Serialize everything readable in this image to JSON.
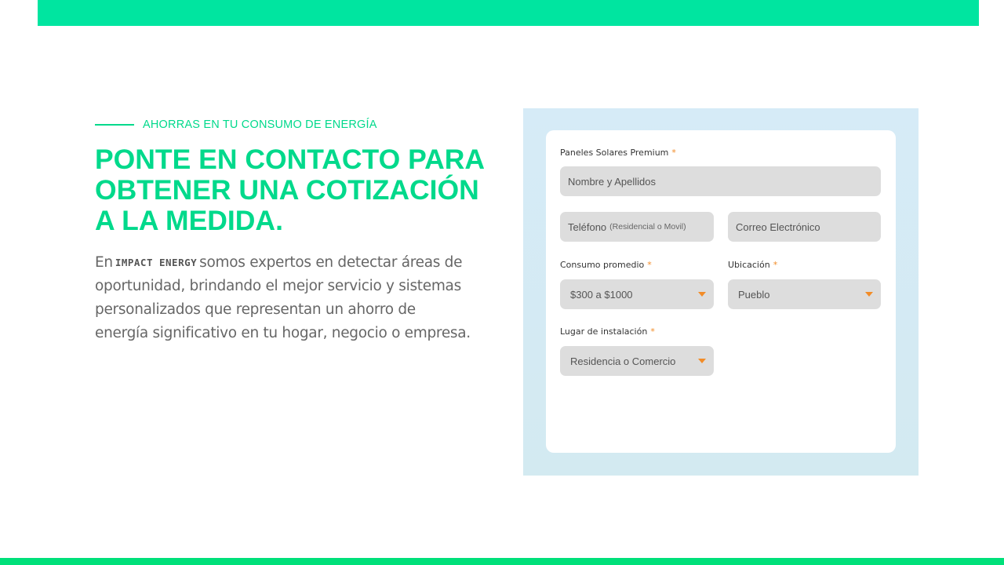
{
  "eyebrow": "AHORRAS EN TU CONSUMO DE ENERGÍA",
  "heading": {
    "line1": "PONTE EN CONTACTO PARA",
    "line2": "OBTENER UNA COTIZACIÓN",
    "line3": "A LA MEDIDA."
  },
  "body": {
    "prefix": "En",
    "brand": "IMPACT ENERGY",
    "line1_rest": "somos expertos en detectar áreas de",
    "line2": "oportunidad, brindando el mejor servicio y sistemas",
    "line3": "personalizados que representan un ahorro de",
    "line4": "energía significativo en tu hogar, negocio o empresa."
  },
  "form": {
    "product_label": "Paneles Solares Premium",
    "required_mark": "*",
    "name_placeholder": "Nombre y Apellidos",
    "phone_placeholder": "Teléfono",
    "phone_hint": "(Residencial o Movil)",
    "email_placeholder": "Correo Electrónico",
    "consumption_label": "Consumo promedio",
    "consumption_value": "$300 a $1000",
    "location_label": "Ubicación",
    "location_value": "Pueblo",
    "installation_label": "Lugar de instalación",
    "installation_value": "Residencia o Comercio"
  },
  "colors": {
    "accent_green": "#00d98b",
    "top_bar": "#00e5a0",
    "required_orange": "#f28c28",
    "field_gray": "#dddddd"
  }
}
